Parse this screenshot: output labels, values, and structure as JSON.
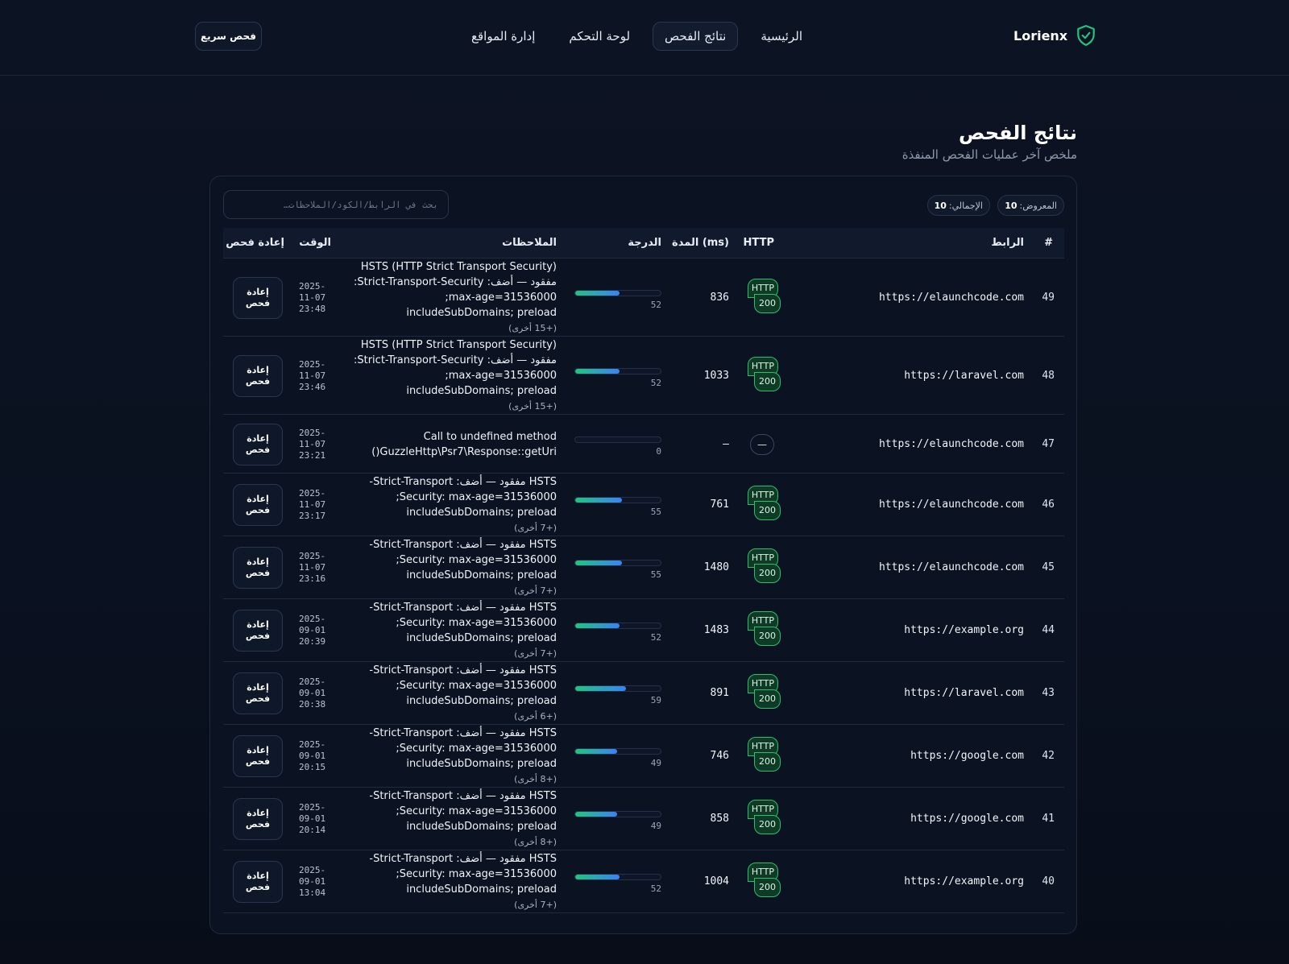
{
  "brand": {
    "name": "Lorienx"
  },
  "nav": [
    {
      "label": "الرئيسية"
    },
    {
      "label": "نتائج الفحص",
      "active": true
    },
    {
      "label": "لوحة التحكم"
    },
    {
      "label": "إدارة المواقع"
    }
  ],
  "header": {
    "quick_scan_label": "فحص سريع"
  },
  "page": {
    "title": "نتائج الفحص",
    "subtitle": "ملخص آخر عمليات الفحص المنفذة"
  },
  "stats": {
    "shown_label": "المعروض:",
    "shown": "10",
    "total_label": "الإجمالي:",
    "total": "10"
  },
  "search": {
    "placeholder": "بحث في الرابط/الكود/الملاحظات…"
  },
  "table": {
    "headers": {
      "id": "#",
      "url": "الرابط",
      "http": "HTTP",
      "duration": "المدة (ms)",
      "score": "الدرجة",
      "notes": "الملاحظات",
      "time": "الوقت",
      "rescan": "إعادة فحص"
    },
    "rescan_label": "إعادة فحص",
    "rows": [
      {
        "id": "49",
        "url": "https://elaunchcode.com",
        "http_label": "HTTP",
        "http_code": "200",
        "duration": "836",
        "score": 52,
        "score_label": "52",
        "notes": [
          "HSTS (HTTP Strict Transport Security)",
          "مفقود — أضف: Strict-Transport-Security:",
          "max-age=31536000;",
          "includeSubDomains; preload"
        ],
        "more": "(+15 أخرى)",
        "time": [
          "2025-",
          "11-07",
          "23:48"
        ]
      },
      {
        "id": "48",
        "url": "https://laravel.com",
        "http_label": "HTTP",
        "http_code": "200",
        "duration": "1033",
        "score": 52,
        "score_label": "52",
        "notes": [
          "HSTS (HTTP Strict Transport Security)",
          "مفقود — أضف: Strict-Transport-Security:",
          "max-age=31536000;",
          "includeSubDomains; preload"
        ],
        "more": "(+15 أخرى)",
        "time": [
          "2025-",
          "11-07",
          "23:46"
        ]
      },
      {
        "id": "47",
        "url": "https://elaunchcode.com",
        "http_label": "—",
        "http_code": "",
        "duration": "—",
        "score": 0,
        "score_label": "0",
        "notes": [
          "Call to undefined method",
          "GuzzleHttp\\Psr7\\Response::getUri()"
        ],
        "more": "",
        "time": [
          "2025-",
          "11-07",
          "23:21"
        ]
      },
      {
        "id": "46",
        "url": "https://elaunchcode.com",
        "http_label": "HTTP",
        "http_code": "200",
        "duration": "761",
        "score": 55,
        "score_label": "55",
        "notes": [
          "HSTS مفقود — أضف: Strict-Transport-",
          "Security: max-age=31536000;",
          "includeSubDomains; preload"
        ],
        "more": "(+7 أخرى)",
        "time": [
          "2025-",
          "11-07",
          "23:17"
        ]
      },
      {
        "id": "45",
        "url": "https://elaunchcode.com",
        "http_label": "HTTP",
        "http_code": "200",
        "duration": "1480",
        "score": 55,
        "score_label": "55",
        "notes": [
          "HSTS مفقود — أضف: Strict-Transport-",
          "Security: max-age=31536000;",
          "includeSubDomains; preload"
        ],
        "more": "(+7 أخرى)",
        "time": [
          "2025-",
          "11-07",
          "23:16"
        ]
      },
      {
        "id": "44",
        "url": "https://example.org",
        "http_label": "HTTP",
        "http_code": "200",
        "duration": "1483",
        "score": 52,
        "score_label": "52",
        "notes": [
          "HSTS مفقود — أضف: Strict-Transport-",
          "Security: max-age=31536000;",
          "includeSubDomains; preload"
        ],
        "more": "(+7 أخرى)",
        "time": [
          "2025-",
          "09-01",
          "20:39"
        ]
      },
      {
        "id": "43",
        "url": "https://laravel.com",
        "http_label": "HTTP",
        "http_code": "200",
        "duration": "891",
        "score": 59,
        "score_label": "59",
        "notes": [
          "HSTS مفقود — أضف: Strict-Transport-",
          "Security: max-age=31536000;",
          "includeSubDomains; preload"
        ],
        "more": "(+6 أخرى)",
        "time": [
          "2025-",
          "09-01",
          "20:38"
        ]
      },
      {
        "id": "42",
        "url": "https://google.com",
        "http_label": "HTTP",
        "http_code": "200",
        "duration": "746",
        "score": 49,
        "score_label": "49",
        "notes": [
          "HSTS مفقود — أضف: Strict-Transport-",
          "Security: max-age=31536000;",
          "includeSubDomains; preload"
        ],
        "more": "(+8 أخرى)",
        "time": [
          "2025-",
          "09-01",
          "20:15"
        ]
      },
      {
        "id": "41",
        "url": "https://google.com",
        "http_label": "HTTP",
        "http_code": "200",
        "duration": "858",
        "score": 49,
        "score_label": "49",
        "notes": [
          "HSTS مفقود — أضف: Strict-Transport-",
          "Security: max-age=31536000;",
          "includeSubDomains; preload"
        ],
        "more": "(+8 أخرى)",
        "time": [
          "2025-",
          "09-01",
          "20:14"
        ]
      },
      {
        "id": "40",
        "url": "https://example.org",
        "http_label": "HTTP",
        "http_code": "200",
        "duration": "1004",
        "score": 52,
        "score_label": "52",
        "notes": [
          "HSTS مفقود — أضف: Strict-Transport-",
          "Security: max-age=31536000;",
          "includeSubDomains; preload"
        ],
        "more": "(+7 أخرى)",
        "time": [
          "2025-",
          "09-01",
          "13:04"
        ]
      }
    ]
  },
  "colors": {
    "accent_green": "#22c57c",
    "accent_blue": "#3b82f6",
    "background": "#0a1120"
  },
  "icons": {
    "brand": "shield-check-icon"
  }
}
